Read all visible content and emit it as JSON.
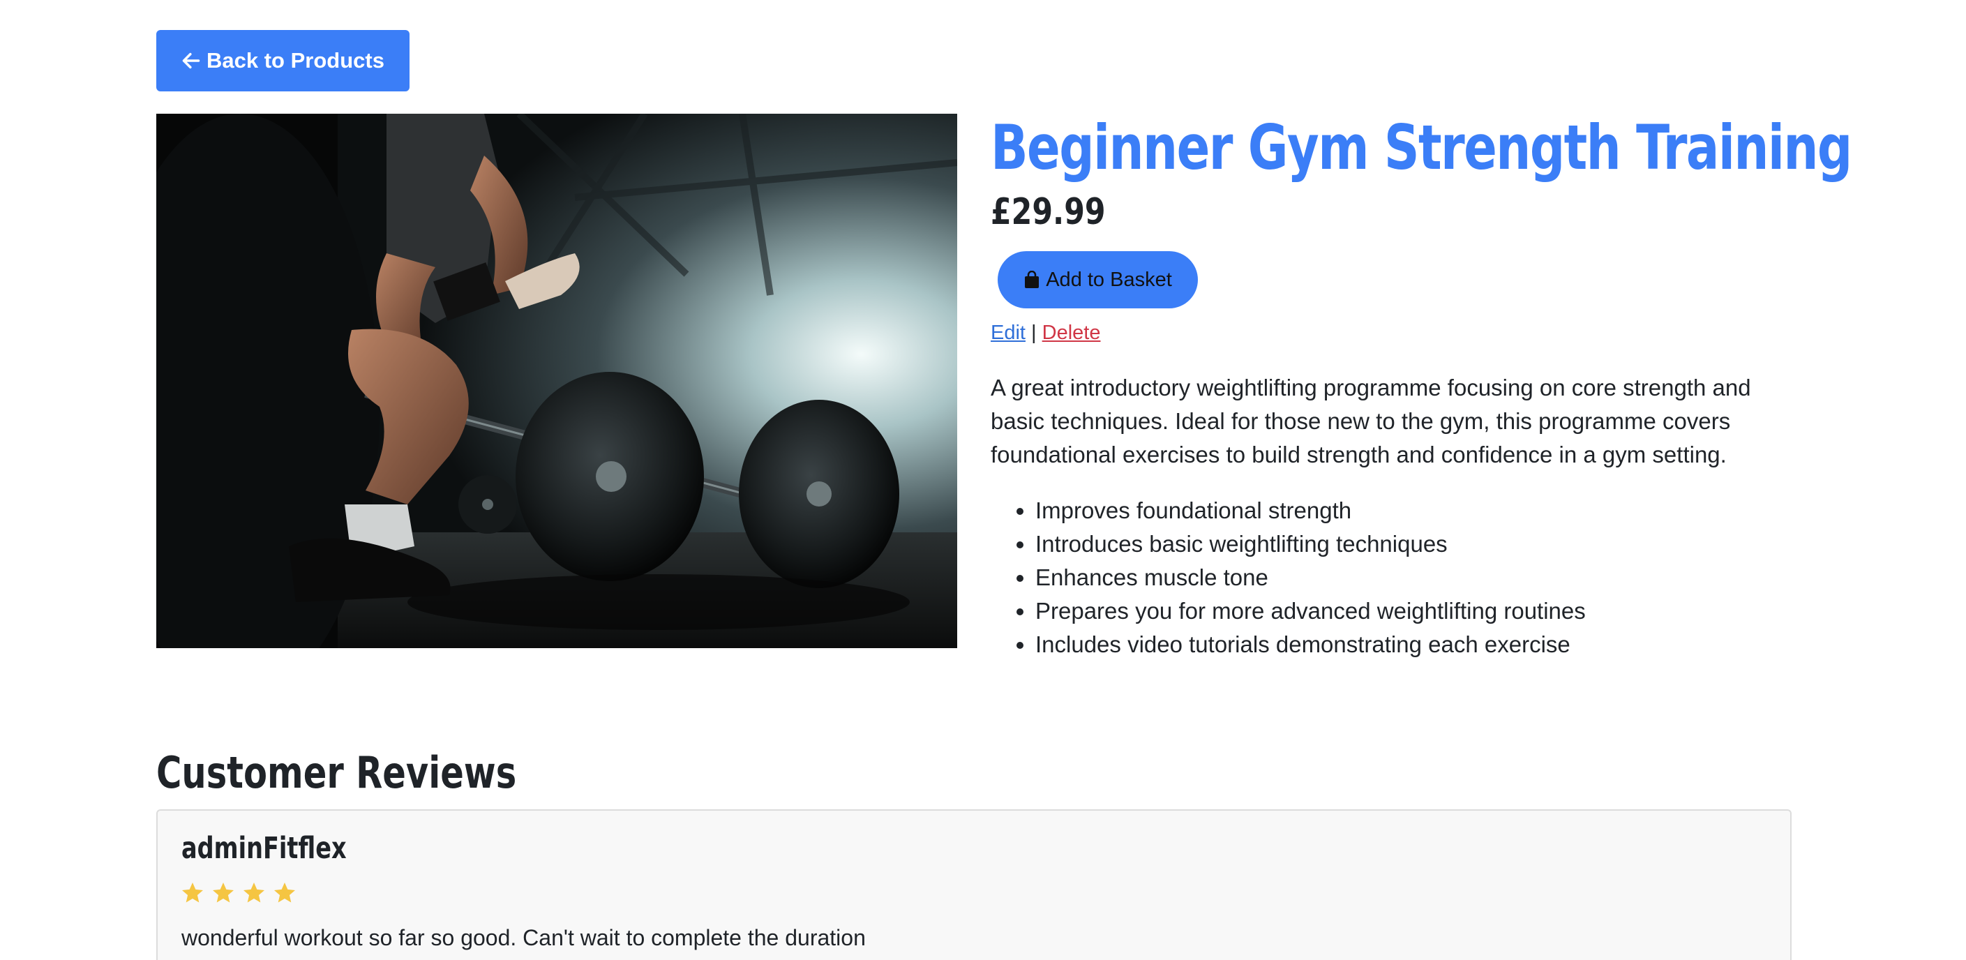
{
  "nav": {
    "back_label": "Back to Products",
    "back_icon": "arrow-left-icon"
  },
  "product": {
    "title": "Beginner Gym Strength Training",
    "price": "£29.99",
    "add_to_basket_label": "Add to Basket",
    "basket_icon": "shopping-bag-icon",
    "edit_label": "Edit",
    "separator": "|",
    "delete_label": "Delete",
    "description": "A great introductory weightlifting programme focusing on core strength and basic techniques. Ideal for those new to the gym, this programme covers foundational exercises to build strength and confidence in a gym setting.",
    "features": [
      "Improves foundational strength",
      "Introduces basic weightlifting techniques",
      "Enhances muscle tone",
      "Prepares you for more advanced weightlifting routines",
      "Includes video tutorials demonstrating each exercise"
    ]
  },
  "reviews": {
    "heading": "Customer Reviews",
    "items": [
      {
        "author": "adminFitflex",
        "rating": 4,
        "text": "wonderful workout so far so good. Can't wait to complete the duration"
      }
    ]
  },
  "colors": {
    "accent": "#3b7ef7",
    "delete": "#d03545",
    "star": "#f5c542"
  }
}
